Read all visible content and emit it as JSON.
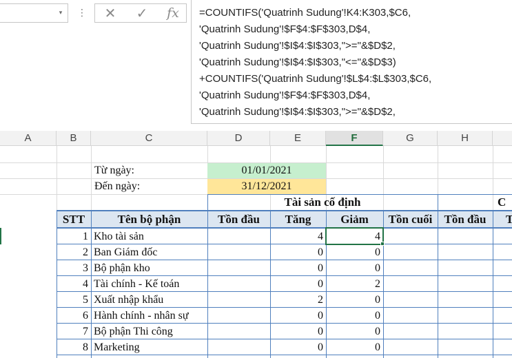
{
  "formula_bar": {
    "dropdown_glyph": "▾",
    "dots_glyph": "⋮",
    "cancel_glyph": "✕",
    "confirm_glyph": "✓",
    "fx_label": "fx",
    "lines": [
      "=COUNTIFS('Quatrinh Sudung'!K4:K303,$C6,",
      "'Quatrinh Sudung'!$F$4:$F$303,D$4,",
      "'Quatrinh Sudung'!$I$4:$I$303,\">=\"&$D$2,",
      "'Quatrinh Sudung'!$I$4:$I$303,\"<=\"&$D$3)",
      "+COUNTIFS('Quatrinh Sudung'!$L$4:$L$303,$C6,",
      "'Quatrinh Sudung'!$F$4:$F$303,D$4,",
      "'Quatrinh Sudung'!$I$4:$I$303,\">=\"&$D$2,"
    ]
  },
  "columns": [
    "A",
    "B",
    "C",
    "D",
    "E",
    "F",
    "G",
    "H"
  ],
  "selected_column": "F",
  "sheet": {
    "from_label": "Từ ngày:",
    "to_label": "Đến ngày:",
    "from_date": "01/01/2021",
    "to_date": "31/12/2021",
    "group_header": "Tài sản cố định",
    "group_header_next": "C",
    "headers": {
      "stt": "STT",
      "dept": "Tên bộ phận",
      "opening": "Tồn đầu",
      "increase": "Tăng",
      "decrease": "Giảm",
      "closing": "Tồn cuối",
      "opening_next": "Tồn đầu",
      "next_partial": "T"
    },
    "rows": [
      {
        "stt": "1",
        "dept": "Kho tài sản",
        "increase": "4",
        "decrease": "4"
      },
      {
        "stt": "2",
        "dept": "Ban Giám đốc",
        "increase": "0",
        "decrease": "0"
      },
      {
        "stt": "3",
        "dept": "Bộ phận kho",
        "increase": "0",
        "decrease": "0"
      },
      {
        "stt": "4",
        "dept": "Tài chính - Kế toán",
        "increase": "0",
        "decrease": "2"
      },
      {
        "stt": "5",
        "dept": "Xuất nhập khẩu",
        "increase": "2",
        "decrease": "0"
      },
      {
        "stt": "6",
        "dept": "Hành chính - nhân sự",
        "increase": "0",
        "decrease": "0"
      },
      {
        "stt": "7",
        "dept": "Bộ phận Thi công",
        "increase": "0",
        "decrease": "0"
      },
      {
        "stt": "8",
        "dept": "Marketing",
        "increase": "0",
        "decrease": "0"
      }
    ]
  },
  "colors": {
    "from_date_fill": "#c6efce",
    "to_date_fill": "#ffe699",
    "header_fill": "#dce6f1",
    "selection": "#217346",
    "border": "#4f7fbd"
  }
}
